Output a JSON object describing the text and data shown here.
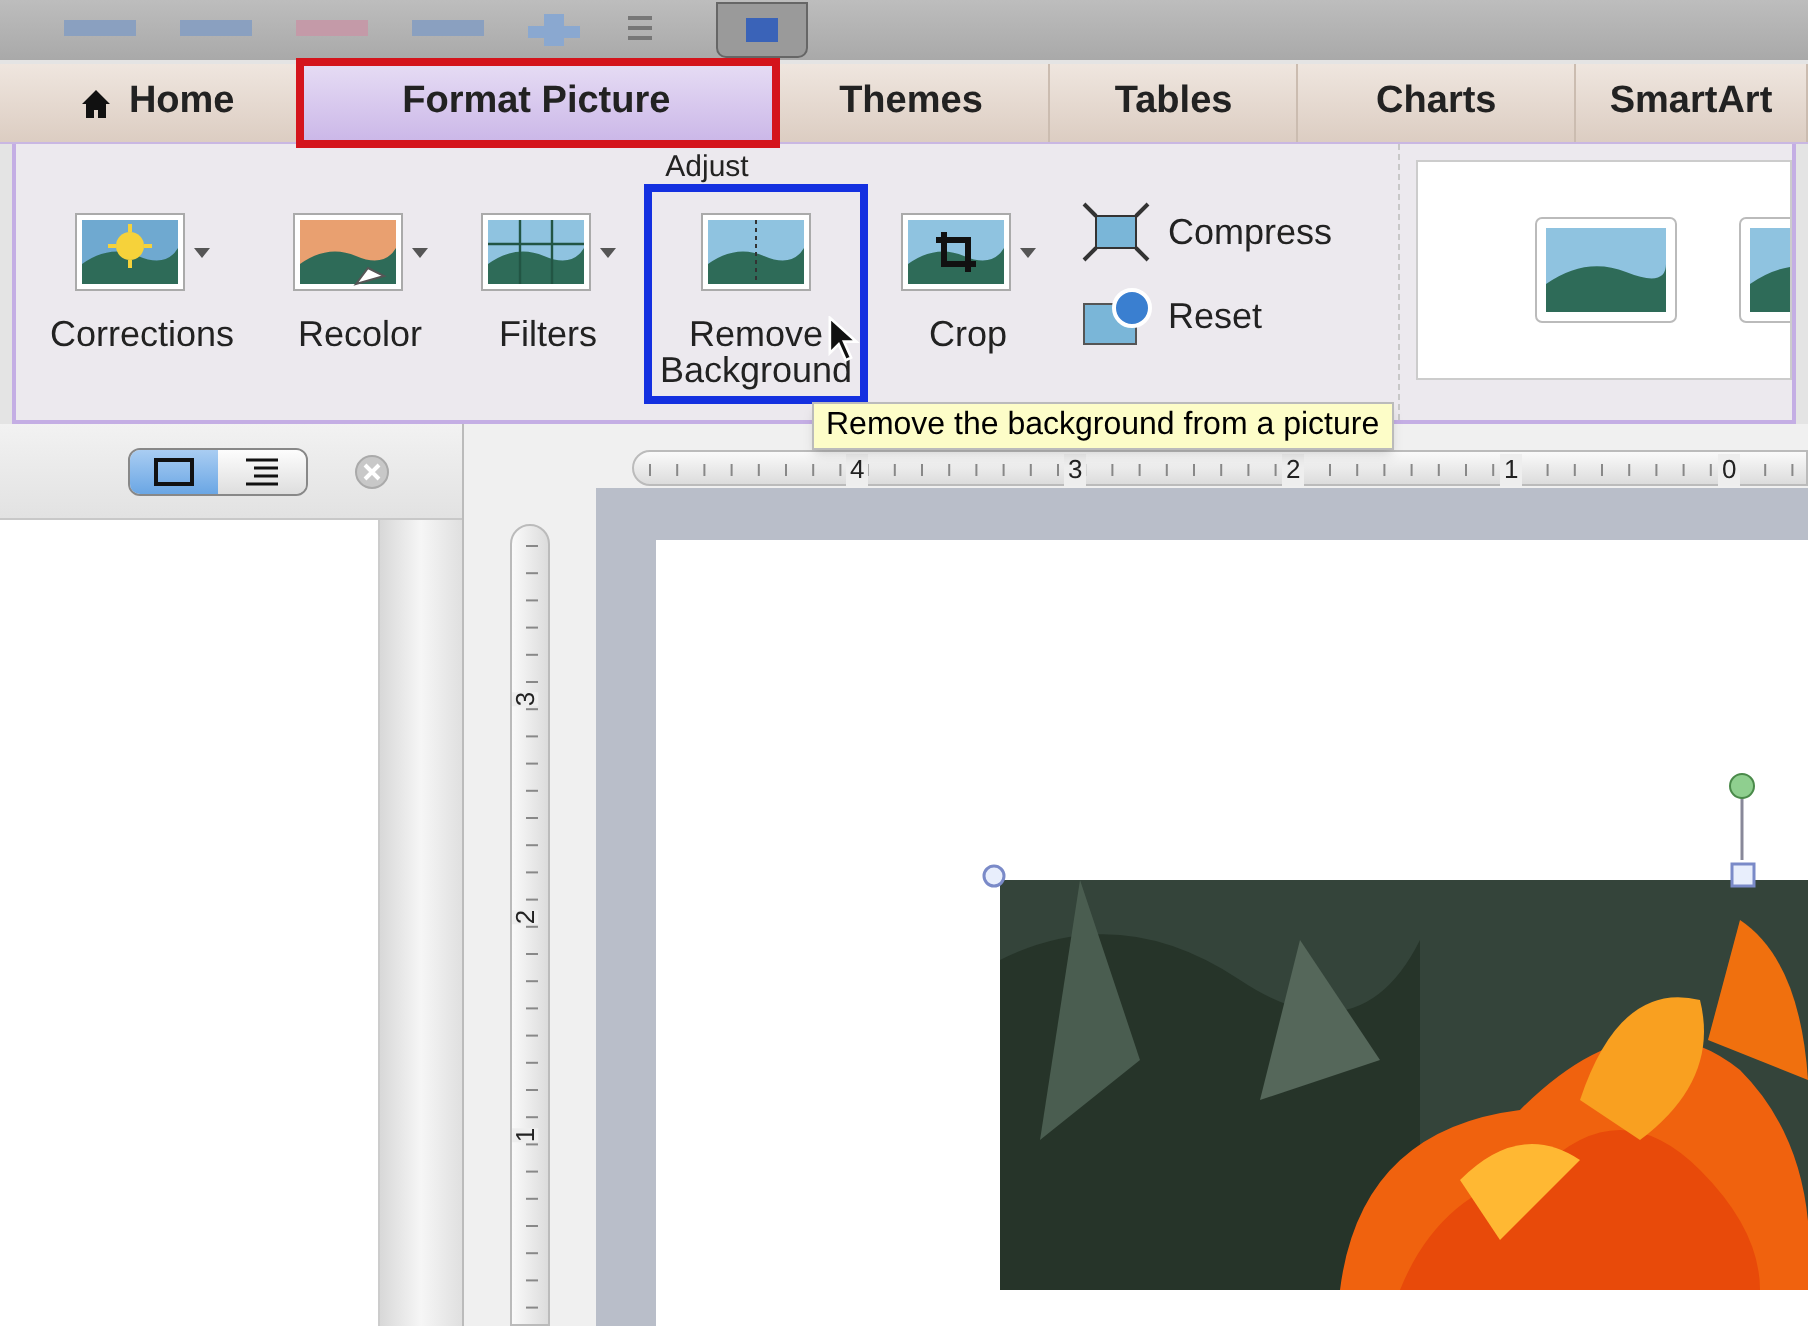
{
  "tabs": [
    {
      "label": "Home",
      "kind": "home",
      "selected": false,
      "highlighted": false
    },
    {
      "label": "Format Picture",
      "kind": "plain",
      "selected": true,
      "highlighted": true
    },
    {
      "label": "Themes",
      "kind": "plain",
      "selected": false,
      "highlighted": false
    },
    {
      "label": "Tables",
      "kind": "plain",
      "selected": false,
      "highlighted": false
    },
    {
      "label": "Charts",
      "kind": "plain",
      "selected": false,
      "highlighted": false
    },
    {
      "label": "SmartArt",
      "kind": "plain",
      "selected": false,
      "highlighted": false
    }
  ],
  "ribbon": {
    "group_label": "Adjust",
    "buttons": [
      {
        "label": "Corrections",
        "kind": "large",
        "dropdown": true,
        "highlighted": false
      },
      {
        "label": "Recolor",
        "kind": "large",
        "dropdown": true,
        "highlighted": false
      },
      {
        "label": "Filters",
        "kind": "large",
        "dropdown": true,
        "highlighted": false
      },
      {
        "label": "Remove Background",
        "kind": "large",
        "dropdown": false,
        "highlighted": true
      },
      {
        "label": "Crop",
        "kind": "large",
        "dropdown": true,
        "highlighted": false
      },
      {
        "label": "Compress",
        "kind": "small"
      },
      {
        "label": "Reset",
        "kind": "small"
      }
    ]
  },
  "tooltip": "Remove the background from a picture",
  "view_buttons": [
    {
      "kind": "normal",
      "selected": true
    },
    {
      "kind": "outline",
      "selected": false
    }
  ],
  "horizontal_ruler": {
    "labels": [
      "4",
      "3",
      "2",
      "1",
      "0"
    ]
  },
  "vertical_ruler": {
    "labels": [
      "3",
      "2",
      "1"
    ]
  },
  "slide": {
    "picture": {
      "kind": "picture",
      "selected": true
    }
  }
}
